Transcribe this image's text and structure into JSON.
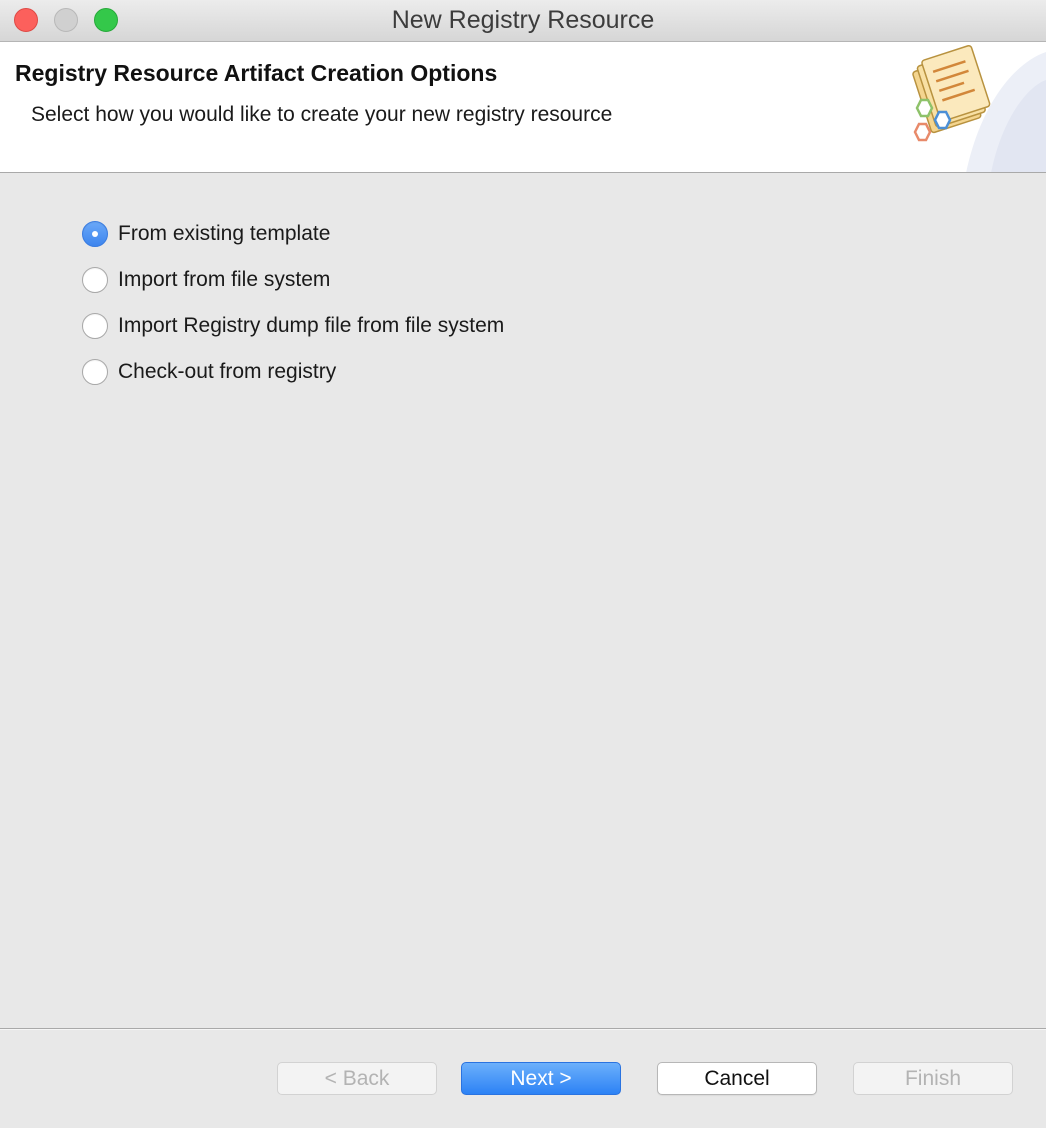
{
  "window": {
    "title": "New Registry Resource"
  },
  "banner": {
    "title": "Registry Resource Artifact Creation Options",
    "subtitle": "Select how you would like to create your new registry resource",
    "icon": "registry-resource-wizard-icon"
  },
  "options": {
    "selected": "From existing template",
    "items": [
      {
        "label": "From existing template",
        "checked": true
      },
      {
        "label": "Import from file system",
        "checked": false
      },
      {
        "label": "Import Registry dump file from file system",
        "checked": false
      },
      {
        "label": "Check-out from registry",
        "checked": false
      }
    ]
  },
  "buttons": {
    "back": {
      "label": "< Back",
      "enabled": false
    },
    "next": {
      "label": "Next >",
      "enabled": true,
      "default": true
    },
    "cancel": {
      "label": "Cancel",
      "enabled": true
    },
    "finish": {
      "label": "Finish",
      "enabled": false
    }
  },
  "colors": {
    "accent": "#3d85ee",
    "close": "#fc605c",
    "zoom": "#34c84a"
  }
}
